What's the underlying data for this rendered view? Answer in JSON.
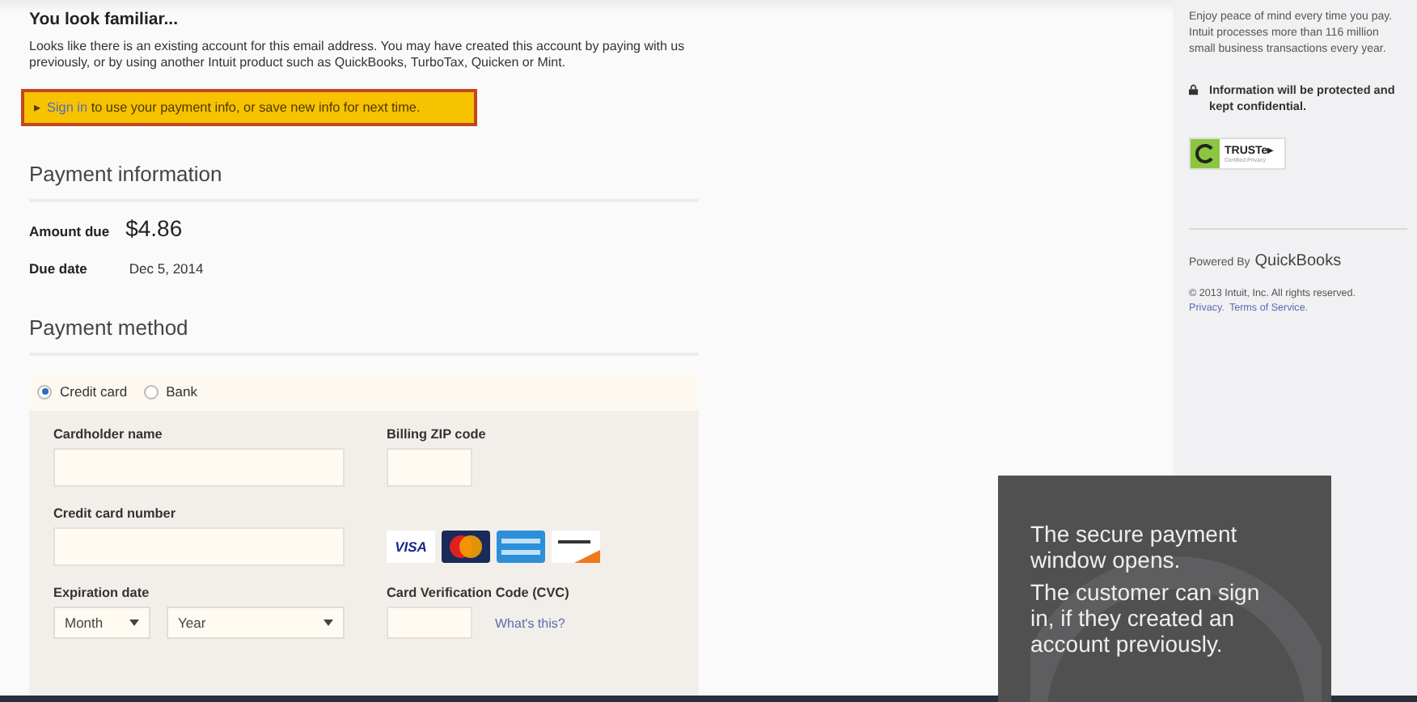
{
  "notice": {
    "title": "You look familiar...",
    "message": "Looks like there is an existing account for this email address. You may have created this account by paying with us previously, or by using another Intuit product such as QuickBooks, TurboTax, Quicken or Mint.",
    "banner_arrow": "▸",
    "banner_link": "Sign in",
    "banner_text": " to use your payment info, or save new info for next time."
  },
  "payment_info": {
    "title": "Payment information",
    "amount_label": "Amount due",
    "amount": "$4.86",
    "due_label": "Due date",
    "due_date": "Dec 5, 2014"
  },
  "payment_method": {
    "title": "Payment method",
    "options": [
      {
        "label": "Credit card",
        "selected": true
      },
      {
        "label": "Bank",
        "selected": false
      }
    ],
    "cardholder_label": "Cardholder name",
    "zip_label": "Billing ZIP code",
    "card_number_label": "Credit card number",
    "cards": [
      {
        "kind": "visa",
        "label": "VISA"
      },
      {
        "kind": "mastercard"
      },
      {
        "kind": "amex"
      },
      {
        "kind": "discover"
      }
    ],
    "expiration_label": "Expiration date",
    "month": "Month",
    "year": "Year",
    "cvc_label": "Card Verification Code (CVC)",
    "cvc_help": "What's this?"
  },
  "sidebar": {
    "intro": "Enjoy peace of mind every time you pay. Intuit processes more than 116 million small business transactions every year.",
    "protected": "Information will be protected and kept confidential.",
    "seal_name": "TRUSTe",
    "seal_arrow": "▸",
    "seal_sub": "Certified Privacy",
    "powered_prefix": "Powered By",
    "powered_brand": "QuickBooks",
    "copyright": "© 2013 Intuit, Inc. All rights reserved.",
    "links": [
      "Privacy.",
      "Terms of Service."
    ]
  },
  "caption": [
    "The secure payment window opens.",
    "The customer can sign in, if they created an account previously."
  ]
}
